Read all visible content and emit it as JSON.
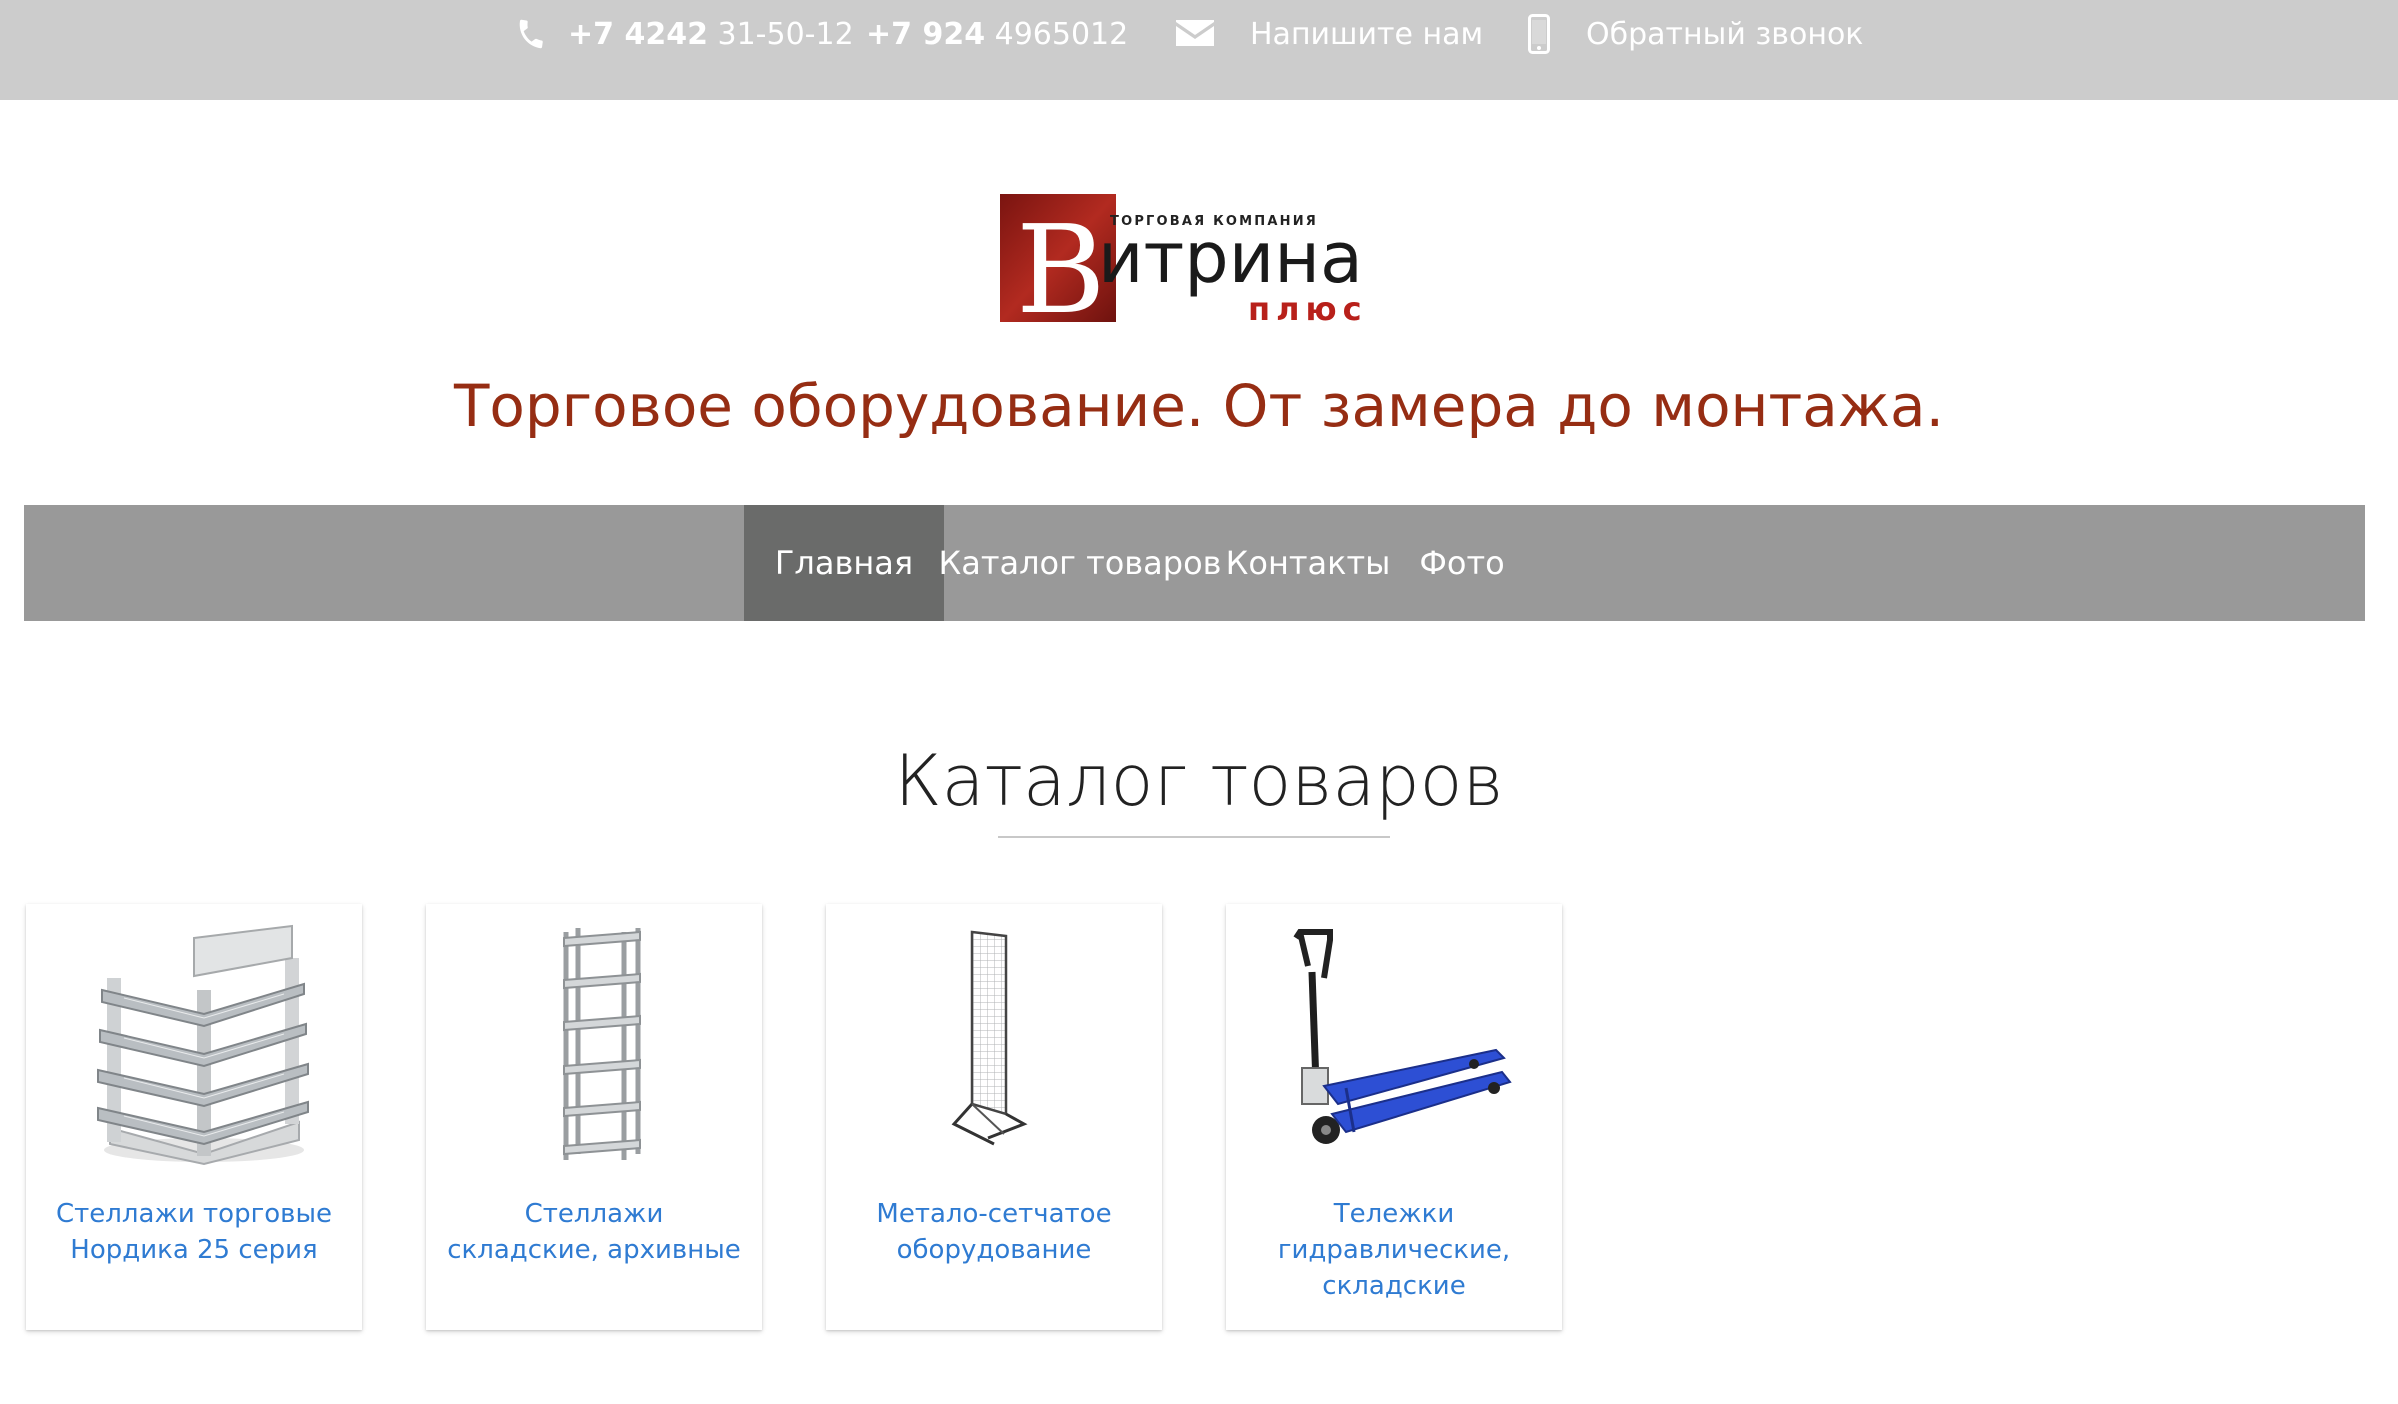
{
  "topbar": {
    "phone1_prefix": "+7 4242",
    "phone1_number": "31-50-12",
    "phone2_prefix": "+7 924",
    "phone2_number": "4965012",
    "write_label": "Напишите нам",
    "callback_label": "Обратный звонок"
  },
  "logo": {
    "letter": "В",
    "small_text": "ТОРГОВАЯ КОМПАНИЯ",
    "main_text": "итрина",
    "sub_text": "плюс"
  },
  "tagline": "Торговое оборудование. От замера до монтажа.",
  "nav": {
    "items": [
      {
        "label": "Главная",
        "active": true
      },
      {
        "label": "Каталог товаров",
        "active": false
      },
      {
        "label": "Контакты",
        "active": false
      },
      {
        "label": "Фото",
        "active": false
      }
    ]
  },
  "catalog": {
    "title": "Каталог товаров",
    "cards": [
      {
        "title": "Стеллажи торговые Нордика 25 серия",
        "image": "retail-shelving"
      },
      {
        "title": "Стеллажи складские, архивные",
        "image": "warehouse-shelving"
      },
      {
        "title": "Метало-сетчатое оборудование",
        "image": "mesh-display-stand"
      },
      {
        "title": "Тележки гидравлические, складские",
        "image": "pallet-jack"
      }
    ]
  },
  "colors": {
    "topbar_bg": "#cccccc",
    "navbar_bg": "#999999",
    "nav_active_bg": "#6a6b6a",
    "tagline": "#962d13",
    "link": "#2f7bd2",
    "logo_red": "#9e1b15"
  }
}
